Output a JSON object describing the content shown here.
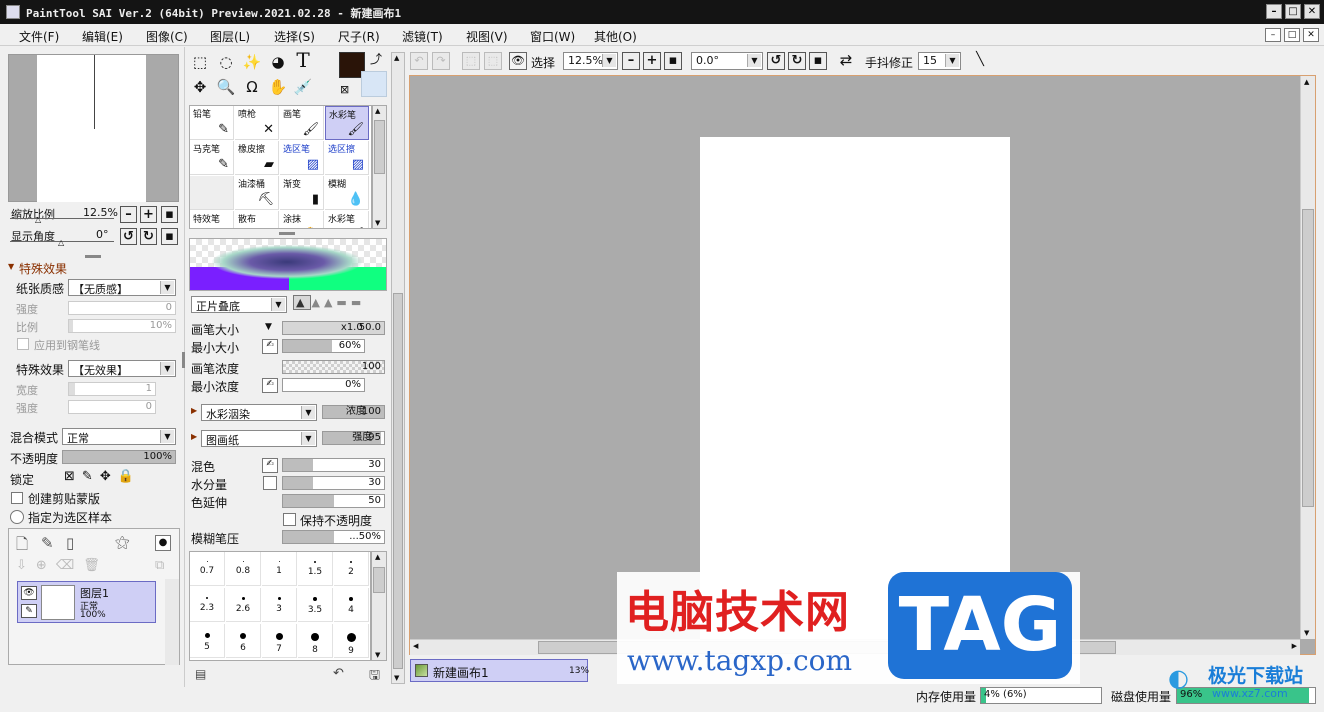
{
  "window": {
    "title": "PaintTool SAI Ver.2 (64bit) Preview.2021.02.28 - 新建画布1",
    "minimize": "–",
    "maximize": "□",
    "close": "✕"
  },
  "menu": [
    "文件(F)",
    "编辑(E)",
    "图像(C)",
    "图层(L)",
    "选择(S)",
    "尺子(R)",
    "滤镜(T)",
    "视图(V)",
    "窗口(W)",
    "其他(O)"
  ],
  "navigator": {
    "zoom_label": "缩放比例",
    "zoom_value": "12.5%",
    "angle_label": "显示角度",
    "angle_value": "0°"
  },
  "effects": {
    "header": "特殊效果",
    "paper_label": "纸张质感",
    "paper_value": "【无质感】",
    "strength_label": "强度",
    "strength_value": "0",
    "scale_label": "比例",
    "scale_value": "10%",
    "apply_pen": "应用到钢笔线",
    "fx_label": "特殊效果",
    "fx_value": "【无效果】",
    "width_label": "宽度",
    "width_value": "1",
    "fx_strength_label": "强度",
    "fx_strength_value": "0"
  },
  "layer_props": {
    "blend_label": "混合模式",
    "blend_value": "正常",
    "opacity_label": "不透明度",
    "opacity_value": "100%",
    "lock_label": "锁定",
    "clip_label": "创建剪贴蒙版",
    "sample_label": "指定为选区样本"
  },
  "layers": [
    {
      "name": "图层1",
      "mode": "正常",
      "opacity": "100%"
    }
  ],
  "tools": {
    "text_tool": "T"
  },
  "brushes": [
    {
      "name": "铅笔",
      "icon": "✎"
    },
    {
      "name": "喷枪",
      "icon": "✕"
    },
    {
      "name": "画笔",
      "icon": "🖌"
    },
    {
      "name": "水彩笔",
      "icon": "🖌"
    },
    {
      "name": "马克笔",
      "icon": "✎"
    },
    {
      "name": "橡皮擦",
      "icon": "▰"
    },
    {
      "name": "选区笔",
      "icon": "▨"
    },
    {
      "name": "选区擦",
      "icon": "▨"
    },
    {
      "name": "",
      "icon": ""
    },
    {
      "name": "油漆桶",
      "icon": "⛏"
    },
    {
      "name": "渐变",
      "icon": "▮"
    },
    {
      "name": "模糊",
      "icon": "💧"
    },
    {
      "name": "特效笔",
      "icon": "✎"
    },
    {
      "name": "散布",
      "icon": "⁘"
    },
    {
      "name": "涂抹",
      "icon": "✋"
    },
    {
      "name": "水彩笔",
      "icon": "🖌"
    }
  ],
  "brush_settings": {
    "blend_mode": "正片叠底",
    "size_label": "画笔大小",
    "size_mult": "x1.0",
    "size_value": "50.0",
    "min_size_label": "最小大小",
    "min_size_value": "60%",
    "density_label": "画笔浓度",
    "density_value": "100",
    "min_density_label": "最小浓度",
    "min_density_value": "0%",
    "shape_value": "水彩洇染",
    "shape_param_label": "浓度",
    "shape_param_value": "100",
    "texture_value": "图画纸",
    "texture_param_label": "强度",
    "texture_param_value": "95",
    "mix_label": "混色",
    "mix_value": "30",
    "water_label": "水分量",
    "water_value": "30",
    "extend_label": "色延伸",
    "extend_value": "50",
    "keep_opacity_label": "保持不透明度",
    "blur_label": "模糊笔压",
    "blur_value": "...50%"
  },
  "brush_sizes": [
    "0.7",
    "0.8",
    "1",
    "1.5",
    "2",
    "2.3",
    "2.6",
    "3",
    "3.5",
    "4",
    "5",
    "6",
    "7",
    "8",
    "9"
  ],
  "brush_size_levels": [
    0.07,
    0.08,
    0.1,
    0.15,
    0.2,
    0.23,
    0.26,
    0.3,
    0.35,
    0.4,
    0.5,
    0.6,
    0.7,
    0.8,
    0.9
  ],
  "toolbar": {
    "select_label": "选择",
    "zoom_value": "12.5%",
    "angle_value": "0.0°",
    "stabilizer_label": "手抖修正",
    "stabilizer_value": "15"
  },
  "canvas_tab": {
    "name": "新建画布1",
    "zoom": "13%"
  },
  "status": {
    "memory_label": "内存使用量",
    "memory_value": "4% (6%)",
    "memory_level": 0.04,
    "disk_label": "磁盘使用量",
    "disk_value": "96%",
    "disk_level": 0.96
  },
  "watermark": {
    "site_name": "电脑技术网",
    "site_url": "www.tagxp.com",
    "tag": "TAG",
    "corner_name": "极光下载站",
    "corner_url": "www.xz7.com"
  },
  "colors": {
    "primary": "#2a1408",
    "secondary": "#d8e6f6",
    "canvas_bg": "#ababab",
    "tag_blue": "#1f73d6",
    "watermark_red": "#e02020",
    "watermark_blue": "#2a66c8"
  }
}
